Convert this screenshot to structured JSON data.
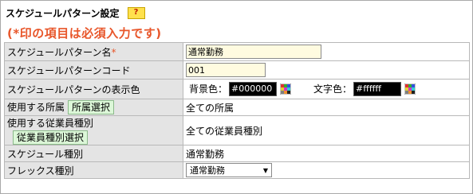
{
  "header": {
    "title": "スケジュールパターン設定",
    "help_label": "?",
    "required_note": "(*印の項目は必須入力です)"
  },
  "rows": {
    "name": {
      "label": "スケジュールパターン名",
      "required_mark": "*",
      "value": "通常勤務"
    },
    "code": {
      "label": "スケジュールパターンコード",
      "value": "001"
    },
    "display_color": {
      "label": "スケジュールパターンの表示色",
      "bg_label": "背景色：",
      "bg_value": "#000000",
      "text_label": "文字色：",
      "text_value": "#ffffff"
    },
    "department": {
      "label": "使用する所属",
      "button": "所属選択",
      "value": "全ての所属"
    },
    "employee_type": {
      "label": "使用する従業員種別",
      "button": "従業員種別選択",
      "value": "全ての従業員種別"
    },
    "schedule_type": {
      "label": "スケジュール種別",
      "value": "通常勤務"
    },
    "flex_type": {
      "label": "フレックス種別",
      "selected": "通常勤務"
    }
  },
  "icons": {
    "palette": "color-palette-icon",
    "dropdown": "chevron-down-icon"
  },
  "colors": {
    "required": "#e8562a",
    "label_bg": "#e4e4e4",
    "input_bg": "#fffbe0",
    "button_bg": "#dcf7d8",
    "help_bg": "#ffe14d"
  }
}
